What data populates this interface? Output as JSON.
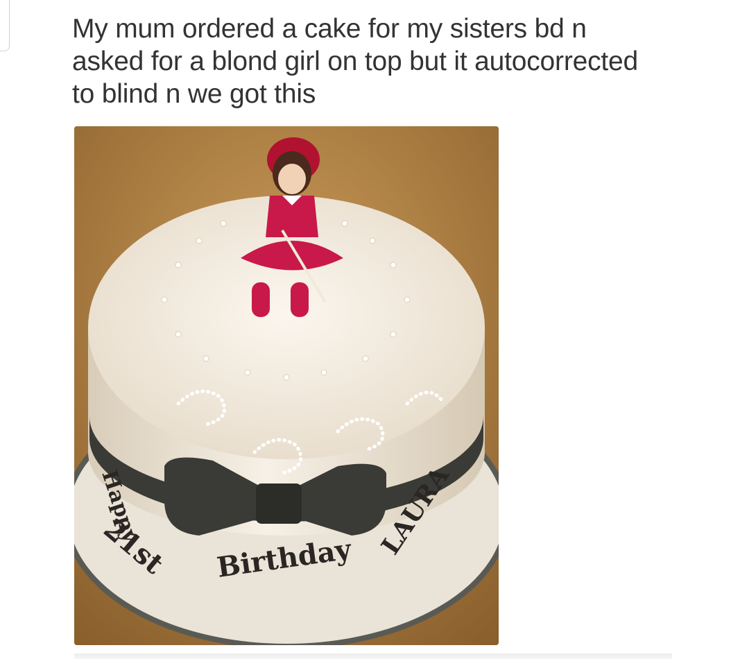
{
  "tweet": {
    "text_lines": [
      "My mum ordered a cake for my sisters bd n",
      "asked for a blond girl on top but it autocorrected",
      "to blind n we got this"
    ]
  },
  "photo": {
    "cake_board_lettering": {
      "happy": "Happy",
      "age": "21st",
      "birthday": "Birthday",
      "name": "LAURA"
    },
    "colors": {
      "table": "#b98a48",
      "fondant": "#f4ece0",
      "ribbon": "#3a3a36",
      "dress": "#c8194a"
    }
  }
}
